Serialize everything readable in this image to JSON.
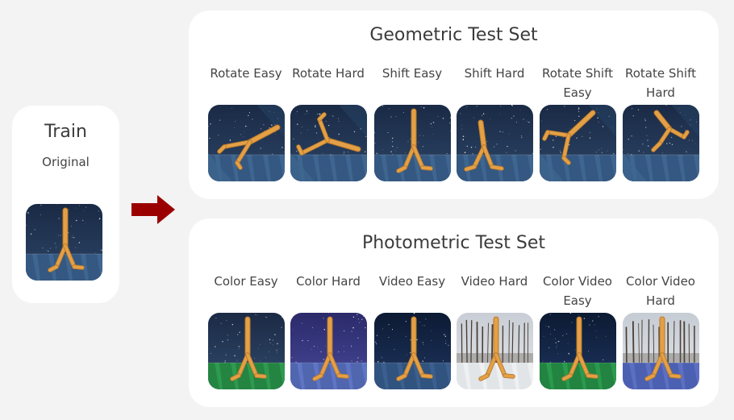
{
  "train": {
    "title": "Train",
    "subtitle": "Original",
    "image": {
      "theme": "original",
      "pose": "stand",
      "icon": "walker-figure-original"
    }
  },
  "arrow": {
    "icon": "right-arrow-icon",
    "color": "#9b0000"
  },
  "geometric": {
    "title": "Geometric Test Set",
    "columns": [
      {
        "label": "Rotate Easy",
        "theme": "original",
        "pose": "rotate-easy"
      },
      {
        "label": "Rotate Hard",
        "theme": "original",
        "pose": "rotate-hard"
      },
      {
        "label": "Shift Easy",
        "theme": "original",
        "pose": "stand"
      },
      {
        "label": "Shift Hard",
        "theme": "original",
        "pose": "shift-hard"
      },
      {
        "label": "Rotate Shift Easy",
        "theme": "original",
        "pose": "rotate-shift-easy"
      },
      {
        "label": "Rotate Shift Hard",
        "theme": "original",
        "pose": "rotate-shift-hard"
      }
    ]
  },
  "photometric": {
    "title": "Photometric Test Set",
    "columns": [
      {
        "label": "Color Easy",
        "theme": "color-easy",
        "pose": "stand"
      },
      {
        "label": "Color Hard",
        "theme": "color-hard",
        "pose": "stand"
      },
      {
        "label": "Video Easy",
        "theme": "video-easy",
        "pose": "stand"
      },
      {
        "label": "Video Hard",
        "theme": "video-hard",
        "pose": "stand"
      },
      {
        "label": "Color Video Easy",
        "theme": "color-video-easy",
        "pose": "stand"
      },
      {
        "label": "Color Video Hard",
        "theme": "color-video-hard",
        "pose": "stand"
      }
    ]
  },
  "colors": {
    "card": "#ffffff",
    "page": "#f3f3f3",
    "limb": "#e3a046",
    "limb_dark": "#b8772a",
    "arrow": "#9b0000"
  }
}
